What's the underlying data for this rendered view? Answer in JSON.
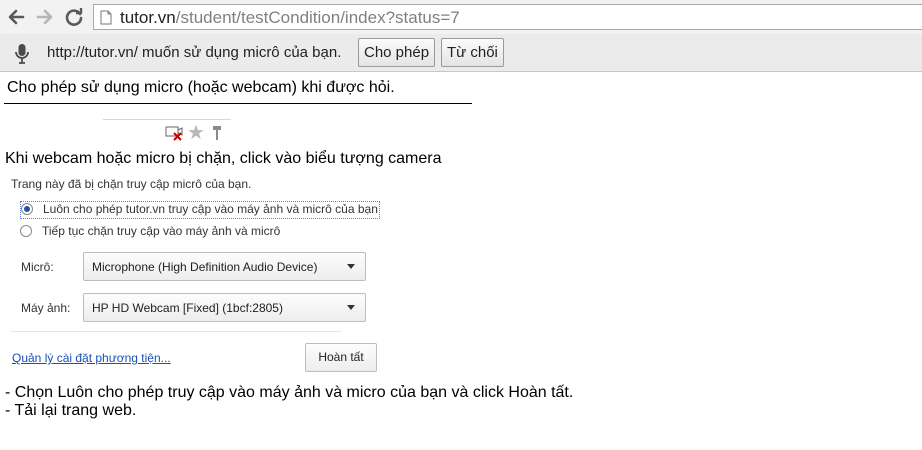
{
  "browser": {
    "url_host": "tutor.vn",
    "url_path": "/student/testCondition/index?status=7",
    "icons": [
      "back-icon",
      "forward-icon",
      "reload-icon",
      "page-icon"
    ]
  },
  "infobar": {
    "message": "http://tutor.vn/ muốn sử dụng micrô của bạn.",
    "allow_label": "Cho phép",
    "deny_label": "Từ chối",
    "icon": "microphone-icon"
  },
  "content": {
    "line1": "Cho phép sử dụng micro (hoặc webcam) khi được hỏi.",
    "line2": "Khi webcam hoặc micro bị chặn, click vào biểu tượng camera",
    "line3": "- Chọn Luôn cho phép truy cập vào máy ảnh và micro của bạn và click Hoàn tất.",
    "line4": "- Tải lại trang web."
  },
  "popup": {
    "title": "Trang này đã bị chặn truy cập micrô của bạn.",
    "option_allow": "Luôn cho phép tutor.vn truy cập vào máy ảnh và micrô của bạn",
    "option_block": "Tiếp tục chặn truy cập vào máy ảnh và micrô",
    "selected_option": "option_allow",
    "mic_label": "Micrô:",
    "mic_value": "Microphone (High Definition Audio Device)",
    "camera_label": "Máy ảnh:",
    "camera_value": "HP HD Webcam [Fixed] (1bcf:2805)",
    "manage_link": "Quản lý cài đặt phương tiện...",
    "done_label": "Hoàn tất"
  },
  "colors": {
    "link": "#1a4fb8",
    "blocked_camera_x": "#cc0000",
    "radio_selected": "#2b4fa0"
  }
}
